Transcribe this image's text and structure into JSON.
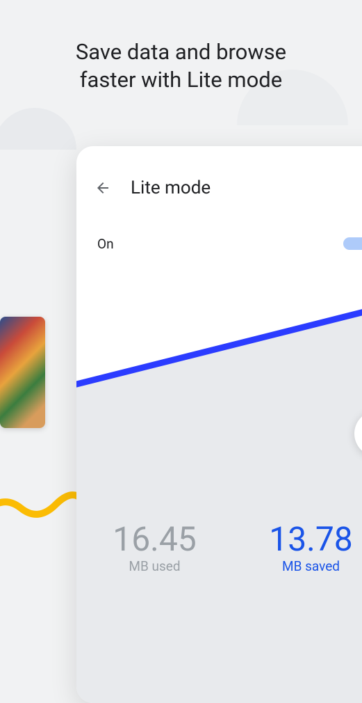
{
  "headline": "Save data and browse\nfaster with Lite mode",
  "screen": {
    "title": "Lite mode",
    "toggle": {
      "state_label": "On",
      "enabled": true
    },
    "stats": {
      "used": {
        "value": "16.45",
        "label": "MB used"
      },
      "saved": {
        "value": "13.78",
        "label": "MB saved"
      }
    }
  }
}
